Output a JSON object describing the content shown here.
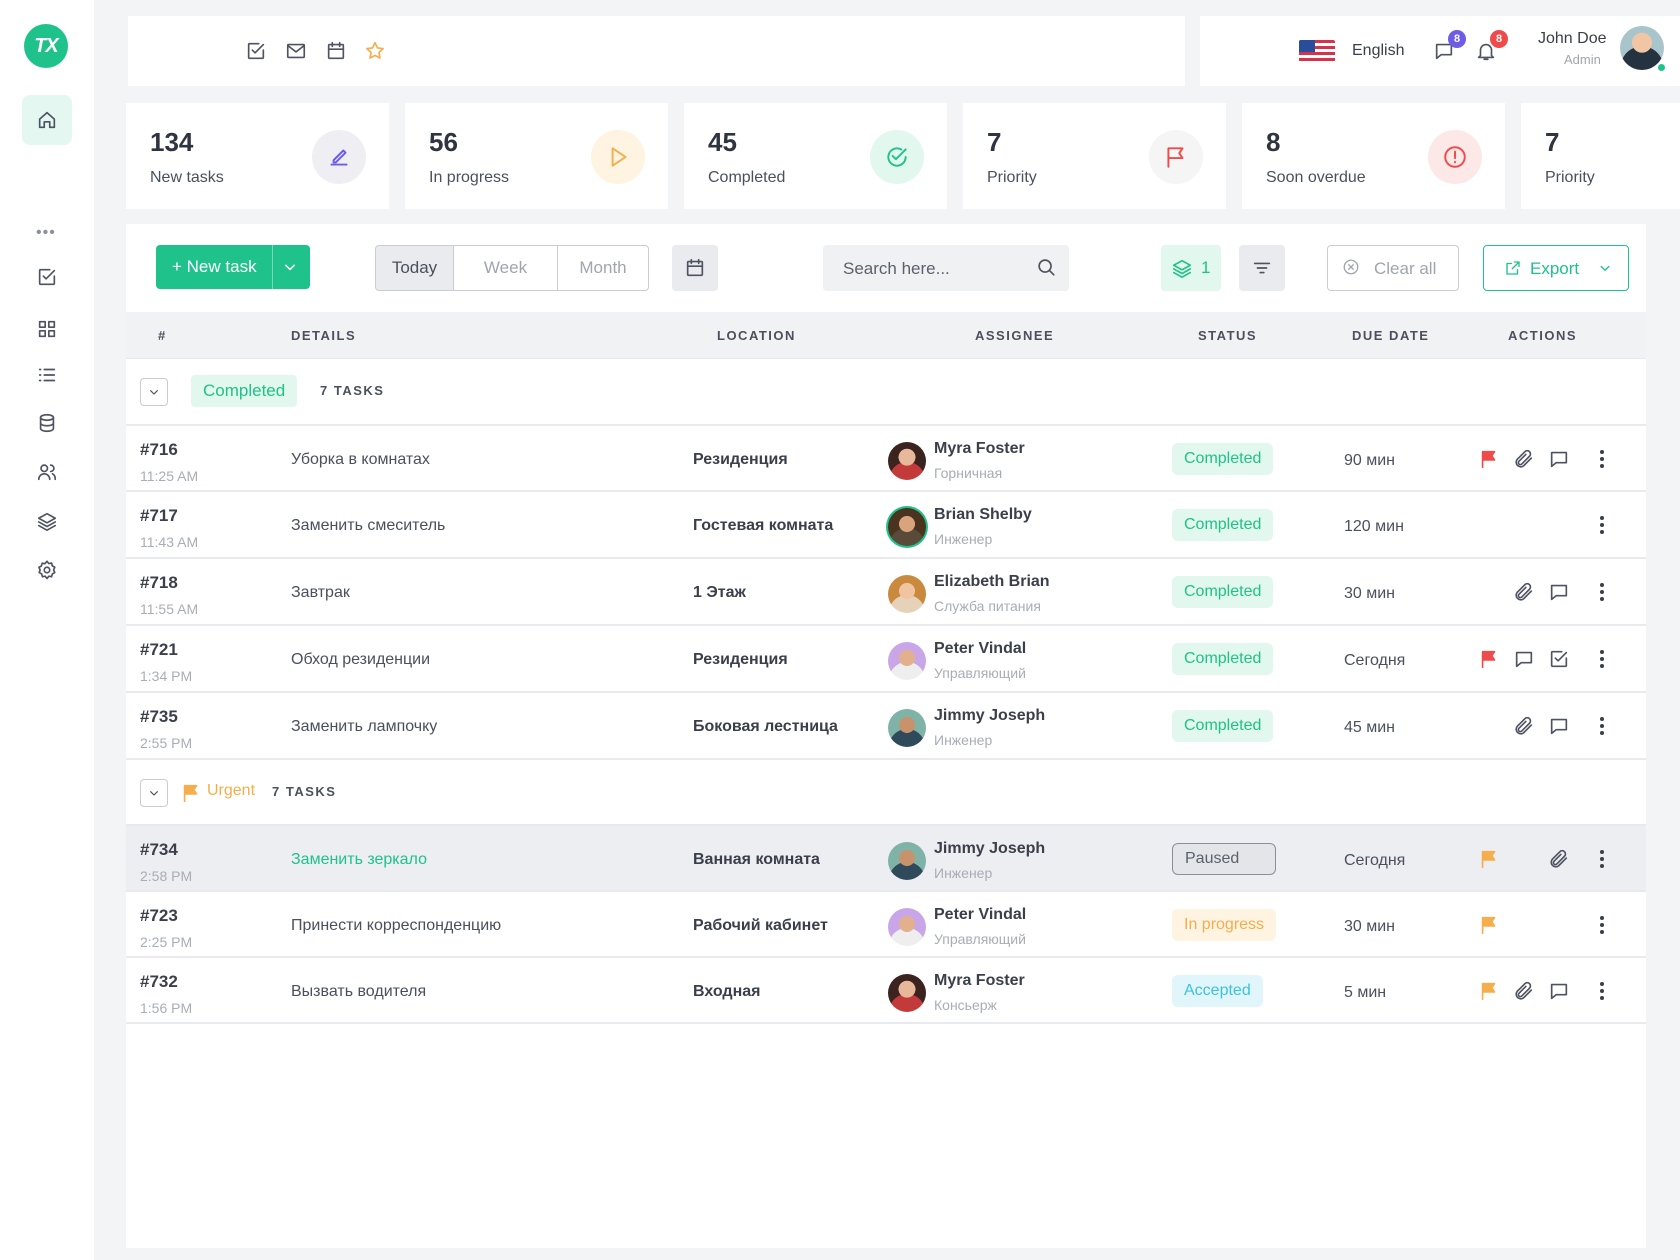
{
  "app": {
    "logo_text": "TX",
    "brand_color": "#1fc28b"
  },
  "topbar": {
    "language": "English",
    "messages_count": "8",
    "notifications_count": "8",
    "user_name": "John Doe",
    "user_role": "Admin"
  },
  "stats": [
    {
      "value": "134",
      "label": "New tasks",
      "icon": "pencil-icon",
      "color": "#6c5ce7"
    },
    {
      "value": "56",
      "label": "In progress",
      "icon": "play-icon",
      "color": "#f6ad4b"
    },
    {
      "value": "45",
      "label": "Completed",
      "icon": "check-circle-icon",
      "color": "#1fc28b"
    },
    {
      "value": "7",
      "label": "Priority",
      "icon": "flag-icon",
      "color": "#ef4b4b"
    },
    {
      "value": "8",
      "label": "Soon overdue",
      "icon": "alert-icon",
      "color": "#ef4b4b"
    },
    {
      "value": "7",
      "label": "Priority",
      "icon": "",
      "color": ""
    }
  ],
  "toolbar": {
    "new_task": "New task",
    "periods": [
      "Today",
      "Week",
      "Month"
    ],
    "search_placeholder": "Search here...",
    "layers_count": "1",
    "clear_all": "Clear all",
    "export": "Export"
  },
  "table": {
    "columns": [
      "#",
      "DETAILS",
      "LOCATION",
      "ASSIGNEE",
      "STATUS",
      "DUE DATE",
      "ACTIONS"
    ],
    "groups": [
      {
        "label": "Completed",
        "count": "7 TASKS"
      },
      {
        "label": "Urgent",
        "count": "7 TASKS"
      }
    ],
    "rows": [
      {
        "id": "#716",
        "time": "11:25 AM",
        "detail": "Уборка в комнатах",
        "location": "Резиденция",
        "name": "Myra Foster",
        "role": "Горничная",
        "status": "Completed",
        "due": "90 мин"
      },
      {
        "id": "#717",
        "time": "11:43 AM",
        "detail": "Заменить смеситель",
        "location": "Гостевая комната",
        "name": "Brian Shelby",
        "role": "Инженер",
        "status": "Completed",
        "due": "120 мин"
      },
      {
        "id": "#718",
        "time": "11:55 AM",
        "detail": "Завтрак",
        "location": "1 Этаж",
        "name": "Elizabeth Brian",
        "role": "Служба питания",
        "status": "Completed",
        "due": "30 мин"
      },
      {
        "id": "#721",
        "time": "1:34 PM",
        "detail": "Обход резиденции",
        "location": "Резиденция",
        "name": "Peter Vindal",
        "role": "Управляющий",
        "status": "Completed",
        "due": "Сегодня"
      },
      {
        "id": "#735",
        "time": "2:55 PM",
        "detail": "Заменить лампочку",
        "location": "Боковая лестница",
        "name": "Jimmy Joseph",
        "role": "Инженер",
        "status": "Completed",
        "due": "45 мин"
      },
      {
        "id": "#734",
        "time": "2:58 PM",
        "detail": "Заменить зеркало",
        "location": "Ванная комната",
        "name": "Jimmy Joseph",
        "role": "Инженер",
        "status": "Paused",
        "due": "Сегодня"
      },
      {
        "id": "#723",
        "time": "2:25 PM",
        "detail": "Принести корреспонденцию",
        "location": "Рабочий кабинет",
        "name": "Peter Vindal",
        "role": "Управляющий",
        "status": "In progress",
        "due": "30 мин"
      },
      {
        "id": "#732",
        "time": "1:56 PM",
        "detail": "Вызвать водителя",
        "location": "Входная",
        "name": "Myra Foster",
        "role": "Консьерж",
        "status": "Accepted",
        "due": "5 мин"
      }
    ]
  }
}
